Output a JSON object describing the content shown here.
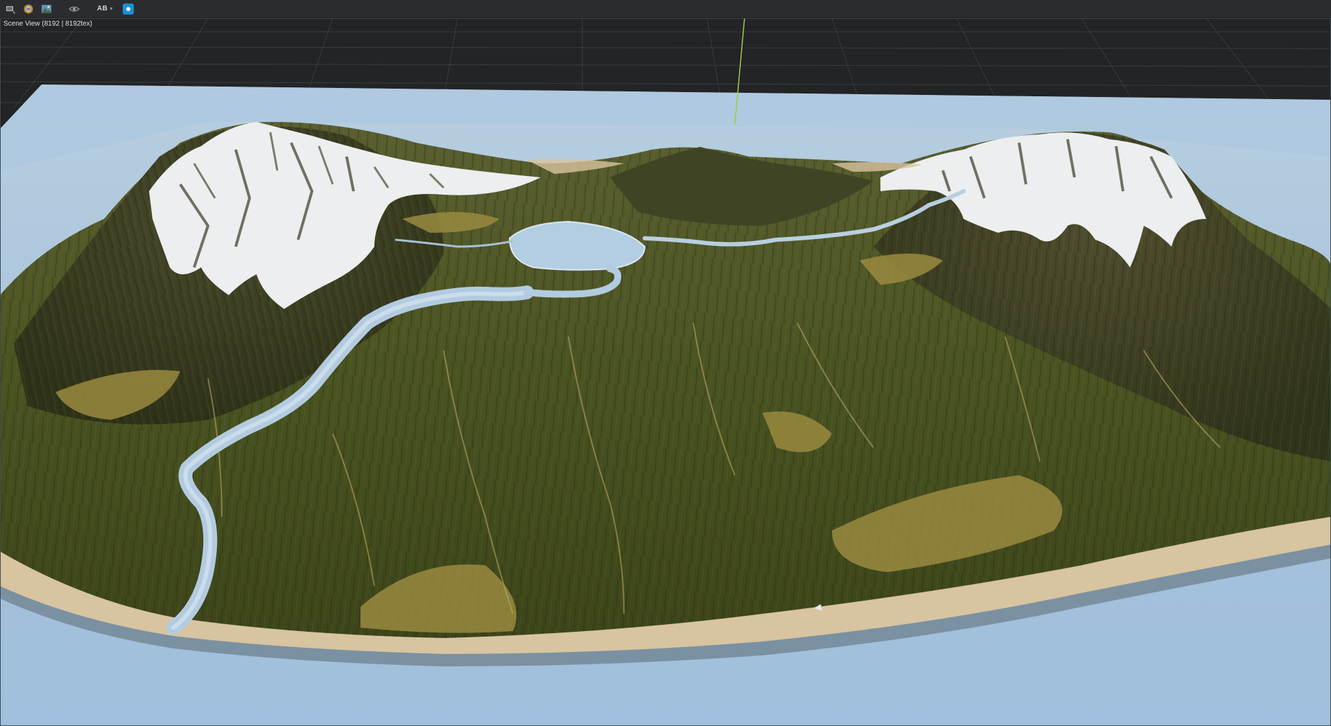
{
  "toolbar": {
    "buttons": [
      {
        "name": "camera-select-icon"
      },
      {
        "name": "render-settings-icon"
      },
      {
        "name": "image-preview-icon"
      },
      {
        "name": "visibility-eye-icon"
      }
    ],
    "ab_label": "AB",
    "active_color": "#1d8fd0"
  },
  "viewport": {
    "label": "Scene View (8192 | 8192tex)"
  },
  "colors": {
    "grid_background": "#232426",
    "grid_lines": "#3a3c3f",
    "water": "#a9c7df",
    "deep_water": "#7fa3c2",
    "sand": "#d9c6a2",
    "grass": "#4f5a24",
    "dry_grass": "#9c8a40",
    "rock": "#3a3824",
    "snow": "#eef0f1",
    "axis": "#9ccf3a"
  }
}
